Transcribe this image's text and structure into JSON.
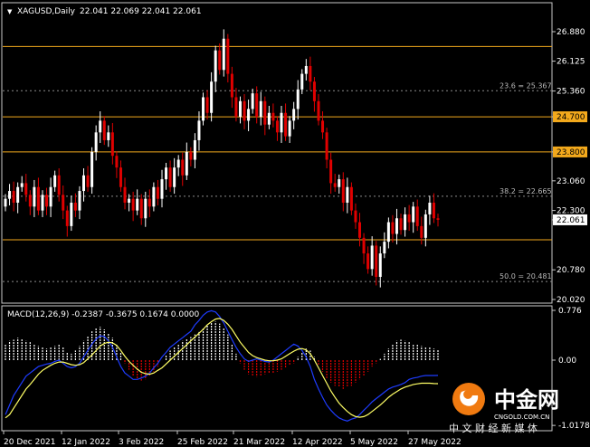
{
  "header": {
    "symbol": "XAGUSD,Daily",
    "ohlc": "22.041 22.069 22.041 22.061",
    "indicator": "MACD(12,26,9) -0.2387 -0.3675 0.1674 0.0000"
  },
  "price_axis": {
    "ticks": [
      "26.880",
      "26.125",
      "25.360",
      "24.700",
      "23.800",
      "23.060",
      "22.300",
      "22.061",
      "20.780",
      "20.020"
    ],
    "levels": [
      {
        "label": "26.500",
        "value": 26.5,
        "color": "#f3a91c"
      },
      {
        "label": "24.700",
        "value": 24.7,
        "color": "#f3a91c"
      },
      {
        "label": "23.800",
        "value": 23.8,
        "color": "#f3a91c"
      },
      {
        "label": "21.550",
        "value": 21.55,
        "color": "#f3a91c"
      }
    ],
    "current_price": "22.061"
  },
  "fib_levels": [
    {
      "label": "23.6 = 25.367",
      "value": 25.367
    },
    {
      "label": "38.2 = 22.665",
      "value": 22.665
    },
    {
      "label": "50.0 = 20.481",
      "value": 20.481
    }
  ],
  "macd_axis": {
    "ticks": [
      "0.776",
      "0.00",
      "-1.0178"
    ],
    "ylim": [
      -1.0178,
      0.776
    ]
  },
  "time_axis": [
    "20 Dec 2021",
    "12 Jan 2022",
    "3 Feb 2022",
    "25 Feb 2022",
    "21 Mar 2022",
    "12 Apr 2022",
    "5 May 2022",
    "27 May 2022"
  ],
  "watermark": {
    "brand": "中金网",
    "domain": "CNGOLD.COM.CN",
    "slogan": "中 文 财 经 新 媒 体"
  },
  "colors": {
    "bull": "#ffffff",
    "bear": "#e00000",
    "level": "#f3a91c",
    "fib": "#8c8c8c",
    "macd_line": "#1e3cff",
    "signal_line": "#ffff66"
  },
  "chart_data": {
    "type": "candlestick",
    "ylim": [
      20.02,
      26.88
    ],
    "close_series": [
      22.6,
      22.8,
      22.5,
      22.9,
      23.0,
      22.7,
      22.4,
      22.9,
      22.3,
      22.7,
      22.4,
      22.9,
      23.2,
      22.7,
      22.3,
      21.9,
      22.5,
      22.3,
      22.8,
      23.2,
      22.9,
      23.8,
      24.3,
      24.6,
      24.1,
      24.3,
      23.7,
      23.4,
      22.9,
      22.5,
      22.6,
      22.3,
      22.6,
      22.1,
      22.6,
      22.4,
      22.9,
      22.6,
      23.1,
      23.4,
      22.9,
      23.4,
      23.6,
      23.2,
      23.8,
      23.6,
      24.1,
      24.6,
      25.2,
      24.8,
      25.6,
      26.4,
      25.9,
      26.7,
      25.8,
      25.2,
      24.7,
      25.1,
      24.6,
      24.9,
      25.3,
      24.7,
      25.1,
      24.5,
      24.8,
      24.6,
      24.3,
      24.8,
      24.2,
      24.6,
      24.9,
      25.4,
      25.8,
      26.0,
      25.6,
      25.1,
      24.6,
      24.3,
      23.6,
      23.0,
      22.9,
      23.1,
      22.5,
      22.9,
      22.3,
      22.0,
      21.6,
      21.2,
      20.8,
      21.4,
      20.6,
      21.2,
      21.5,
      22.0,
      21.7,
      22.1,
      21.8,
      22.2,
      22.0,
      22.4,
      21.9,
      21.6,
      22.2,
      22.5,
      22.1,
      22.061
    ],
    "macd_histogram": [
      0.25,
      0.3,
      0.32,
      0.35,
      0.33,
      0.3,
      0.28,
      0.25,
      0.22,
      0.2,
      0.18,
      0.2,
      0.22,
      0.25,
      0.2,
      0.12,
      0.1,
      0.15,
      0.22,
      0.3,
      0.38,
      0.45,
      0.5,
      0.52,
      0.48,
      0.42,
      0.35,
      0.25,
      0.12,
      -0.05,
      -0.15,
      -0.25,
      -0.3,
      -0.32,
      -0.3,
      -0.25,
      -0.18,
      -0.1,
      0.0,
      0.08,
      0.15,
      0.2,
      0.25,
      0.3,
      0.33,
      0.36,
      0.4,
      0.44,
      0.5,
      0.55,
      0.58,
      0.6,
      0.57,
      0.5,
      0.4,
      0.25,
      0.1,
      -0.05,
      -0.15,
      -0.22,
      -0.25,
      -0.26,
      -0.25,
      -0.22,
      -0.2,
      -0.2,
      -0.18,
      -0.15,
      -0.12,
      -0.08,
      -0.05,
      0.05,
      0.12,
      0.18,
      0.15,
      0.05,
      -0.08,
      -0.18,
      -0.28,
      -0.35,
      -0.4,
      -0.42,
      -0.45,
      -0.42,
      -0.4,
      -0.35,
      -0.3,
      -0.25,
      -0.18,
      -0.1,
      -0.05,
      0.02,
      0.1,
      0.18,
      0.25,
      0.3,
      0.32,
      0.3,
      0.28,
      0.25,
      0.24,
      0.22,
      0.2,
      0.2,
      0.18,
      0.17
    ],
    "macd_line": [
      -0.85,
      -0.7,
      -0.55,
      -0.45,
      -0.35,
      -0.25,
      -0.2,
      -0.15,
      -0.1,
      -0.08,
      -0.06,
      -0.05,
      -0.02,
      0.0,
      -0.05,
      -0.1,
      -0.12,
      -0.1,
      -0.05,
      0.05,
      0.15,
      0.25,
      0.33,
      0.38,
      0.37,
      0.3,
      0.2,
      0.05,
      -0.1,
      -0.2,
      -0.25,
      -0.3,
      -0.3,
      -0.28,
      -0.25,
      -0.2,
      -0.12,
      -0.05,
      0.05,
      0.12,
      0.2,
      0.25,
      0.3,
      0.35,
      0.4,
      0.45,
      0.55,
      0.62,
      0.7,
      0.75,
      0.77,
      0.75,
      0.68,
      0.58,
      0.45,
      0.32,
      0.2,
      0.1,
      0.02,
      -0.02,
      0.0,
      0.02,
      0.0,
      -0.02,
      -0.03,
      0.0,
      0.05,
      0.1,
      0.15,
      0.2,
      0.25,
      0.22,
      0.15,
      0.05,
      -0.1,
      -0.3,
      -0.45,
      -0.58,
      -0.7,
      -0.78,
      -0.85,
      -0.9,
      -0.93,
      -0.95,
      -0.92,
      -0.9,
      -0.85,
      -0.78,
      -0.72,
      -0.65,
      -0.6,
      -0.55,
      -0.5,
      -0.45,
      -0.42,
      -0.4,
      -0.38,
      -0.35,
      -0.3,
      -0.28,
      -0.27,
      -0.25,
      -0.24,
      -0.24,
      -0.24,
      -0.2387
    ],
    "signal_line": [
      -0.9,
      -0.85,
      -0.75,
      -0.65,
      -0.55,
      -0.45,
      -0.38,
      -0.3,
      -0.22,
      -0.16,
      -0.12,
      -0.08,
      -0.05,
      -0.03,
      -0.03,
      -0.05,
      -0.07,
      -0.08,
      -0.07,
      -0.04,
      0.02,
      0.08,
      0.15,
      0.22,
      0.26,
      0.28,
      0.27,
      0.23,
      0.15,
      0.06,
      -0.02,
      -0.08,
      -0.14,
      -0.19,
      -0.21,
      -0.22,
      -0.2,
      -0.16,
      -0.12,
      -0.06,
      0.0,
      0.06,
      0.12,
      0.18,
      0.24,
      0.3,
      0.36,
      0.42,
      0.48,
      0.55,
      0.6,
      0.64,
      0.65,
      0.62,
      0.56,
      0.48,
      0.38,
      0.28,
      0.2,
      0.12,
      0.07,
      0.04,
      0.02,
      0.0,
      -0.01,
      -0.01,
      0.0,
      0.02,
      0.06,
      0.1,
      0.14,
      0.17,
      0.18,
      0.16,
      0.1,
      0.0,
      -0.12,
      -0.24,
      -0.36,
      -0.48,
      -0.58,
      -0.67,
      -0.74,
      -0.8,
      -0.85,
      -0.88,
      -0.89,
      -0.88,
      -0.85,
      -0.8,
      -0.75,
      -0.7,
      -0.64,
      -0.58,
      -0.53,
      -0.49,
      -0.45,
      -0.42,
      -0.4,
      -0.38,
      -0.37,
      -0.36,
      -0.36,
      -0.36,
      -0.365,
      -0.3675
    ]
  }
}
